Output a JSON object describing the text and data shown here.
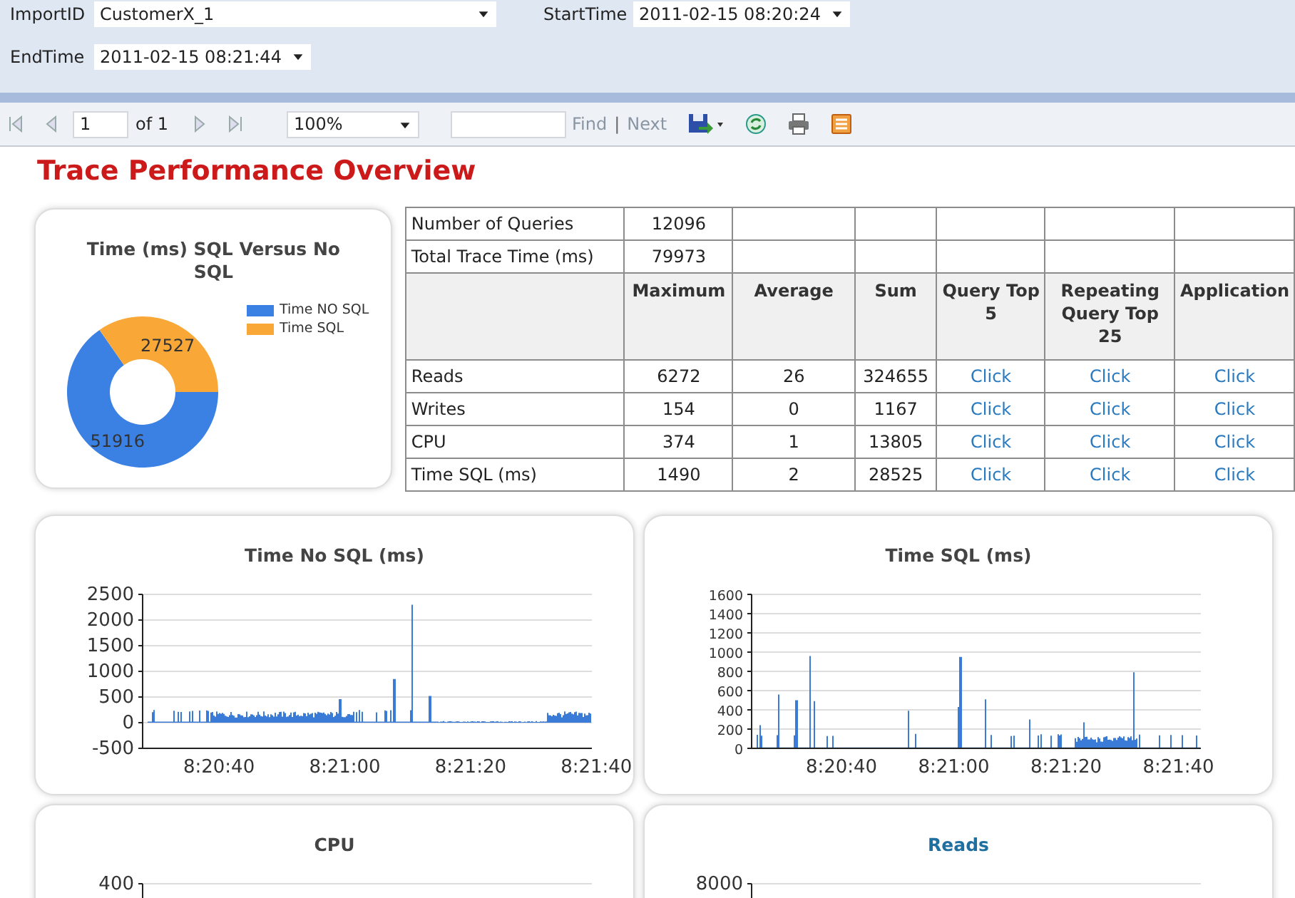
{
  "parameters": [
    {
      "label": "ImportID",
      "value": "CustomerX_1"
    },
    {
      "label": "StartTime",
      "value": "2011-02-15 08:20:24"
    },
    {
      "label": "EndTime",
      "value": "2011-02-15 08:21:44"
    }
  ],
  "toolbar": {
    "page": "1",
    "page_count": "of 1",
    "zoom": "100%",
    "find": "Find",
    "separator": "|",
    "next": "Next"
  },
  "title": "Trace Performance Overview",
  "donut": {
    "chart_data": {
      "type": "donut",
      "title": "Time (ms) SQL Versus No SQL",
      "categories": [
        "Time NO SQL",
        "Time SQL"
      ],
      "colors": [
        "#3b80e3",
        "#f9a838"
      ],
      "series": [
        {
          "values": [
            51916,
            27527
          ]
        }
      ],
      "data_labels": true
    }
  },
  "table": {
    "summary": [
      {
        "label": "Number of Queries",
        "value": "12096"
      },
      {
        "label": "Total Trace Time (ms)",
        "value": "79973"
      }
    ],
    "columns": [
      "Maximum",
      "Average",
      "Sum",
      "Query Top 5",
      "Repeating Query Top 25",
      "Application"
    ],
    "rows": [
      {
        "label": "Reads",
        "values": [
          "6272",
          "26",
          "324655"
        ],
        "links": [
          "Click",
          "Click",
          "Click"
        ]
      },
      {
        "label": "Writes",
        "values": [
          "154",
          "0",
          "1167"
        ],
        "links": [
          "Click",
          "Click",
          "Click"
        ]
      },
      {
        "label": "CPU",
        "values": [
          "374",
          "1",
          "13805"
        ],
        "links": [
          "Click",
          "Click",
          "Click"
        ]
      },
      {
        "label": "Time SQL (ms)",
        "values": [
          "1490",
          "2",
          "28525"
        ],
        "links": [
          "Click",
          "Click",
          "Click"
        ]
      }
    ]
  },
  "charts": [
    {
      "title": "Time No SQL (ms)",
      "link": false,
      "y_labels": [
        "2500",
        "2000",
        "1500",
        "1000",
        "500",
        "0",
        "-500"
      ],
      "x_labels": [
        "8:20:40",
        "8:21:00",
        "8:21:20",
        "8:21:40"
      ]
    },
    {
      "title": "Time SQL (ms)",
      "link": false,
      "y_labels": [
        "1600",
        "1400",
        "1200",
        "1000",
        "800",
        "600",
        "400",
        "200",
        "0"
      ],
      "x_labels": [
        "8:20:40",
        "8:21:00",
        "8:21:20",
        "8:21:40"
      ]
    },
    {
      "title": "CPU",
      "link": false,
      "y_labels": [
        "400"
      ]
    },
    {
      "title": "Reads",
      "link": true,
      "y_labels": [
        "8000"
      ]
    }
  ]
}
